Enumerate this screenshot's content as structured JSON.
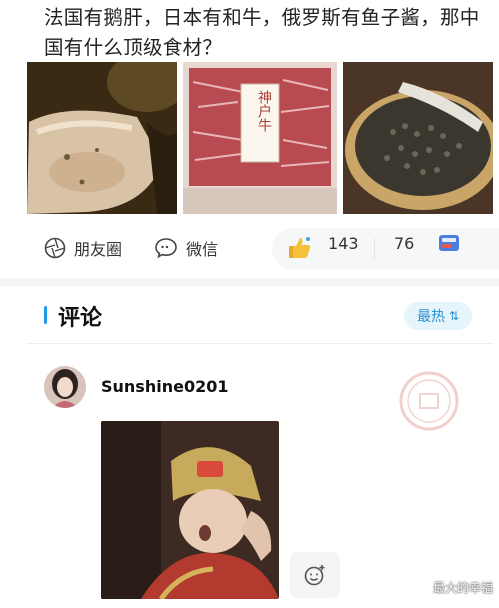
{
  "post": {
    "title": "法国有鹅肝，日本有和牛，俄罗斯有鱼子酱，那中国有什么顶级食材？",
    "images": [
      {
        "icon": "foie-gras-image"
      },
      {
        "icon": "kobe-beef-image",
        "sign_text": "神户牛"
      },
      {
        "icon": "caviar-image"
      }
    ]
  },
  "actions": {
    "moments_label": "朋友圈",
    "wechat_label": "微信",
    "like_count": "143",
    "comment_count": "76"
  },
  "comments": {
    "section_title": "评论",
    "sort_label": "最热",
    "first": {
      "username": "Sunshine0201"
    }
  },
  "watermark": "最大的幸福",
  "colors": {
    "accent": "#1e9be8",
    "sort_bg": "#e6f4fb",
    "band": "#f4f5f7",
    "stamp": "#e6a9a0"
  }
}
